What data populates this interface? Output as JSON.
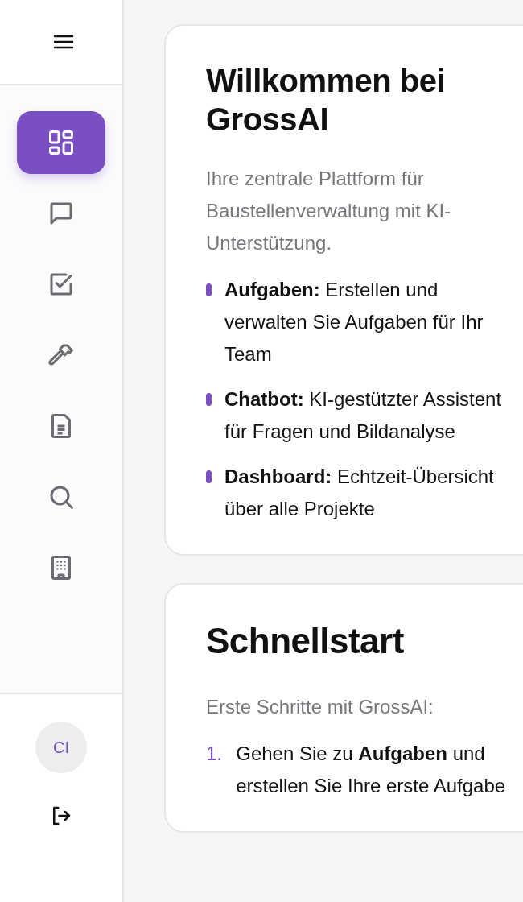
{
  "sidebar": {
    "nav_items": [
      {
        "selected": true
      },
      {
        "selected": false
      },
      {
        "selected": false
      },
      {
        "selected": false
      },
      {
        "selected": false
      },
      {
        "selected": false
      },
      {
        "selected": false
      }
    ],
    "avatar": "CI"
  },
  "welcome_card": {
    "title": "Willkommen bei GrossAI",
    "intro": "Ihre zentrale Plattform für Baustellenverwaltung mit KI-Unterstützung.",
    "features": [
      "**Aufgaben:** Erstellen und verwalten Sie Aufgaben für Ihr Team",
      "**Chatbot:** KI-gestützter Assistent für Fragen und Bildanalyse",
      "**Dashboard:** Echtzeit-Übersicht über alle Projekte"
    ]
  },
  "quickstart_card": {
    "title": "Schnellstart",
    "intro": "Erste Schritte mit GrossAI:",
    "steps": [
      {
        "number": "1.",
        "text": "Gehen Sie zu **Aufgaben** und erstellen Sie Ihre erste Aufgabe"
      }
    ]
  }
}
